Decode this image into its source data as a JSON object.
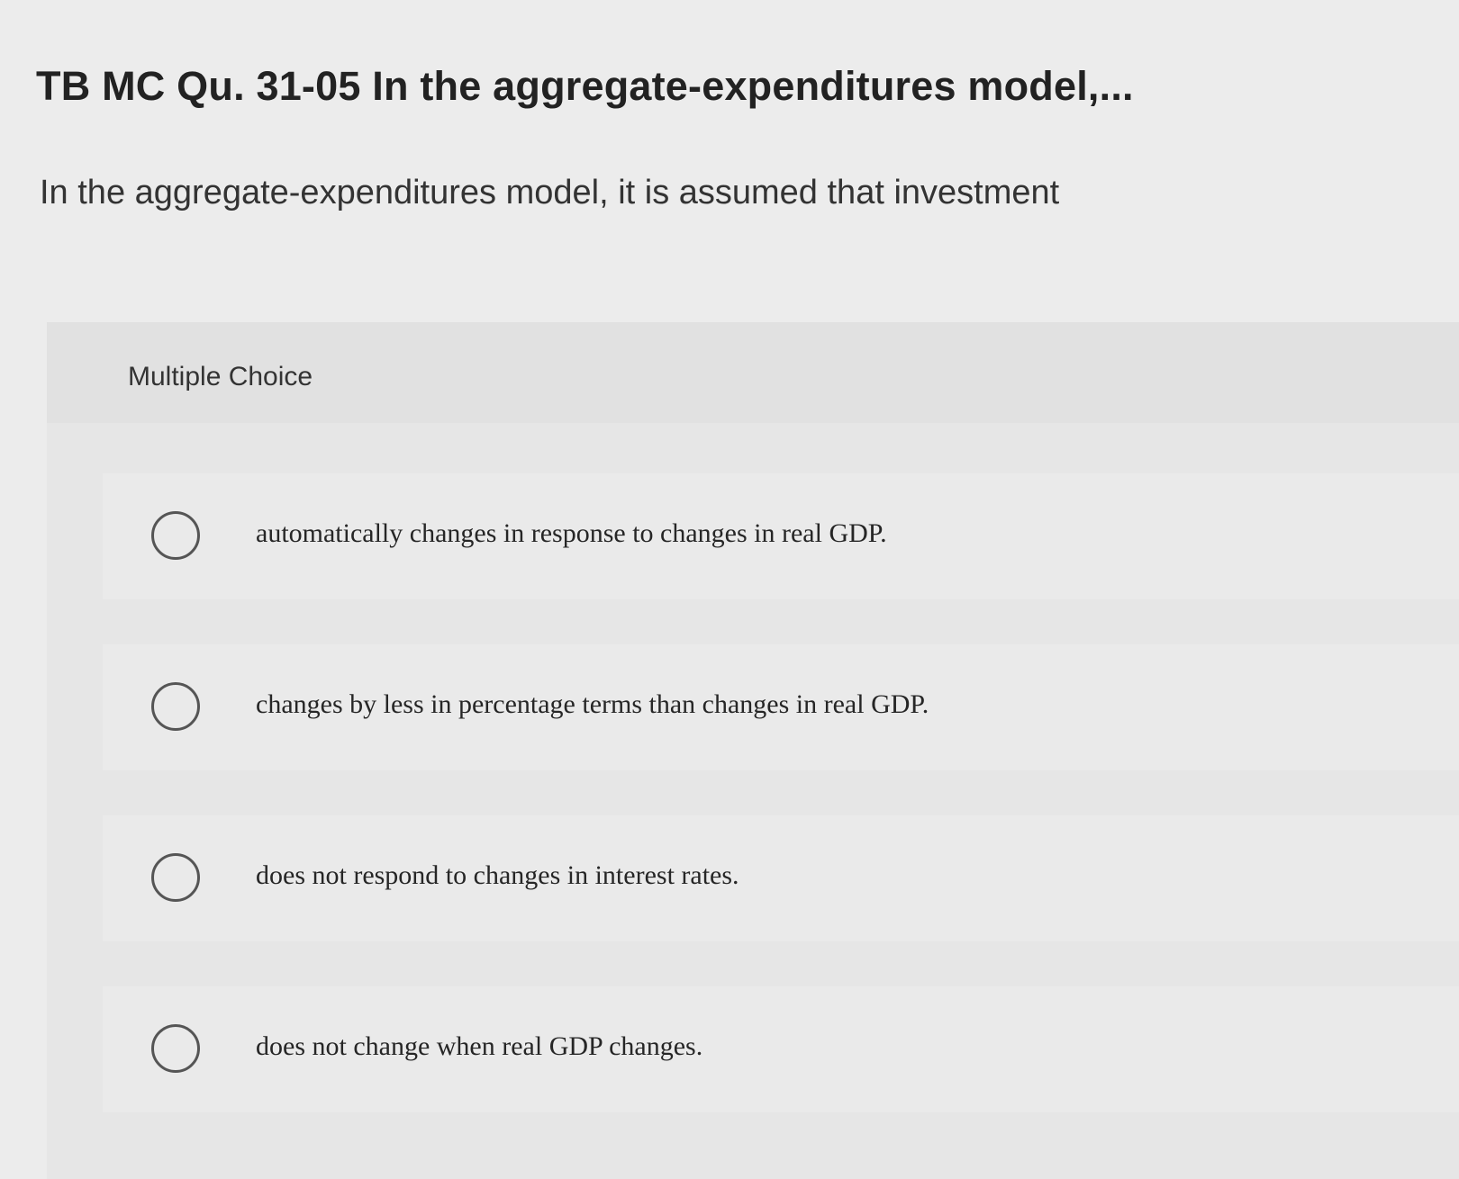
{
  "question": {
    "title": "TB MC Qu. 31-05 In the aggregate-expenditures model,...",
    "prompt": "In the aggregate-expenditures model, it is assumed that investment",
    "type_label": "Multiple Choice"
  },
  "choices": [
    {
      "label": "automatically changes in response to changes in real GDP.",
      "selected": false
    },
    {
      "label": "changes by less in percentage terms than changes in real GDP.",
      "selected": false
    },
    {
      "label": "does not respond to changes in interest rates.",
      "selected": false
    },
    {
      "label": "does not change when real GDP changes.",
      "selected": false
    }
  ]
}
